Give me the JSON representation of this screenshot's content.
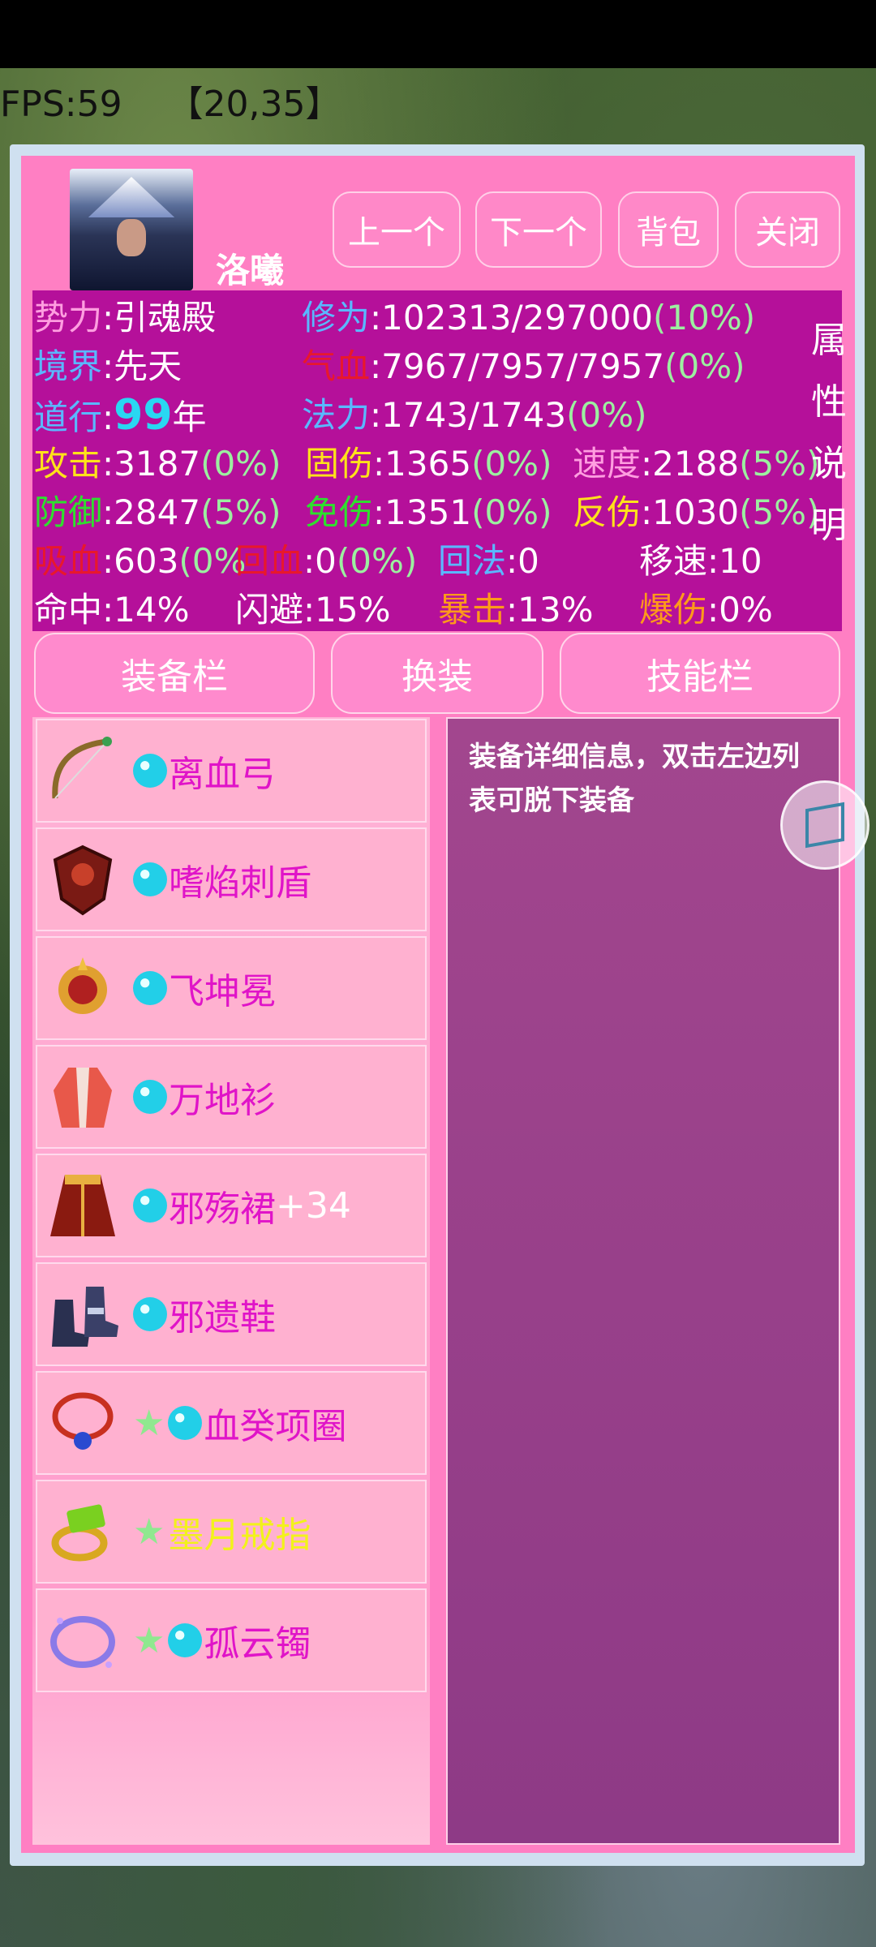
{
  "hud": {
    "fps": "FPS:59",
    "coords": "【20,35】"
  },
  "character": {
    "name": "洛曦"
  },
  "buttons": {
    "prev": "上一个",
    "next": "下一个",
    "bag": "背包",
    "close": "关闭"
  },
  "attr_side": [
    "属",
    "性",
    "说",
    "明"
  ],
  "stats": {
    "faction_label": "势力",
    "faction_value": ":引魂殿",
    "cultivation_label": "修为",
    "cultivation_value": ":102313/297000",
    "cultivation_pct": "(10%)",
    "realm_label": "境界",
    "realm_value": ":先天",
    "hp_label": "气血",
    "hp_value": ":7967/7957/7957",
    "hp_pct": "(0%)",
    "dao_label": "道行",
    "dao_sep": ":",
    "dao_value": "99",
    "dao_unit": "年",
    "mana_label": "法力",
    "mana_value": ":1743/1743",
    "mana_pct": "(0%)",
    "atk_label": "攻击",
    "atk_value": ":3187",
    "atk_pct": "(0%)",
    "fixdmg_label": "固伤",
    "fixdmg_value": ":1365",
    "fixdmg_pct": "(0%)",
    "speed_label": "速度",
    "speed_value": ":2188",
    "speed_pct": "(5%)",
    "def_label": "防御",
    "def_value": ":2847",
    "def_pct": "(5%)",
    "immune_label": "免伤",
    "immune_value": ":1351",
    "immune_pct": "(0%)",
    "reflect_label": "反伤",
    "reflect_value": ":1030",
    "reflect_pct": "(5%)",
    "lifesteal_label": "吸血",
    "lifesteal_value": ":603",
    "lifesteal_pct": "(0%",
    "regen_label": "回血",
    "regen_value": ":0",
    "regen_pct": "(0%)",
    "manaregen_label": "回法",
    "manaregen_value": ":0",
    "move_label": "移速",
    "move_value": ":10",
    "hit_label": "命中",
    "hit_value": ":14%",
    "dodge_label": "闪避",
    "dodge_value": ":15%",
    "crit_label": "暴击",
    "crit_value": ":13%",
    "critdmg_label": "爆伤",
    "critdmg_value": ":0%"
  },
  "tabs": [
    "装备栏",
    "换装",
    "技能栏"
  ],
  "equipment": [
    {
      "name": "离血弓",
      "suffix": "",
      "star": false,
      "color": "#e014c8"
    },
    {
      "name": "嗜焰刺盾",
      "suffix": "",
      "star": false,
      "color": "#e014c8"
    },
    {
      "name": "飞坤冕",
      "suffix": "",
      "star": false,
      "color": "#e014c8"
    },
    {
      "name": "万地衫",
      "suffix": "",
      "star": false,
      "color": "#e014c8"
    },
    {
      "name": "邪殇裙",
      "suffix": "+34",
      "star": false,
      "color": "#e014c8"
    },
    {
      "name": "邪遗鞋",
      "suffix": "",
      "star": false,
      "color": "#e014c8"
    },
    {
      "name": "血癸项圈",
      "suffix": "",
      "star": true,
      "color": "#e014c8"
    },
    {
      "name": "墨月戒指",
      "suffix": "",
      "star": true,
      "color": "#f2f21a"
    },
    {
      "name": "孤云镯",
      "suffix": "",
      "star": true,
      "color": "#e014c8"
    }
  ],
  "detail_text": "装备详细信息，双击左边列表可脱下装备",
  "colors": {
    "panel": "#ff7fc3",
    "stats_bg": "#b5109a",
    "detail_bg": "#9a4290",
    "star": "#8fe88f",
    "yinyang": "#22cfe8"
  }
}
